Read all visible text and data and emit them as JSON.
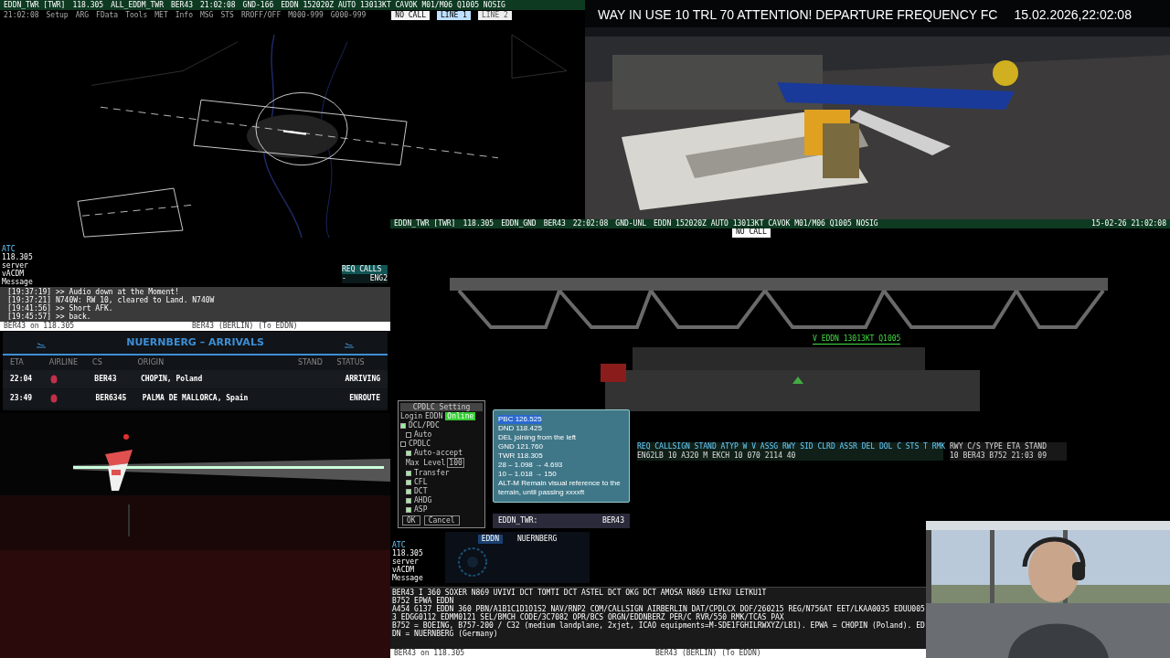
{
  "radar": {
    "toolbar": [
      "EDDN_TWR [TWR]",
      "118.305",
      "ALL_EDDM_TWR",
      "BER43",
      "21:02:08",
      "GND-166"
    ],
    "metar": "EDDN 152020Z AUTO 13013KT CAVOK M01/M06 Q1005 NOSIG",
    "menu": [
      "21:02:08",
      "Setup",
      "ARG",
      "FData",
      "Tools",
      "MET",
      "Info",
      "MSG",
      "STS",
      "RROFF/OFF",
      "M000-999",
      "G000-999"
    ],
    "call_status": "NO CALL",
    "lines": [
      {
        "label": "LINE 1",
        "selected": true
      },
      {
        "label": "LINE 2",
        "selected": false
      }
    ],
    "atc_box": [
      "ATC",
      "118.305",
      "server",
      "vACDM",
      "Message"
    ],
    "req_box": {
      "heading": "REQ CALLS",
      "values": [
        "-",
        "ENG2"
      ]
    },
    "messages": [
      "[19:37:19] >> Audio down at the Moment!",
      "[19:37:21] N740W: RW 10, cleared to Land. N740W",
      "[19:41:56] >> Short AFK.",
      "[19:45:57] >> back."
    ],
    "input": "BER43 on 118.305",
    "status": "BER43 (BERLIN) (To EDDN)"
  },
  "camera": {
    "ticker": "WAY IN USE 10 TRL 70 ATTENTION! DEPARTURE FREQUENCY FC",
    "datetime": "15.02.2026,22:02:08"
  },
  "arrivals": {
    "title": "NUERNBERG – ARRIVALS",
    "columns": [
      "ETA",
      "AIRLINE",
      "CS",
      "ORIGIN",
      "STAND",
      "STATUS"
    ],
    "rows": [
      {
        "eta": "22:04",
        "cs": "BER43",
        "origin": "CHOPIN, Poland",
        "status": "ARRIVING"
      },
      {
        "eta": "23:49",
        "cs": "BER6345",
        "origin": "PALMA DE MALLORCA, Spain",
        "status": "ENROUTE"
      }
    ]
  },
  "ground": {
    "toolbar": [
      "EDDN_TWR [TWR]",
      "118.305",
      "EDDN_GND",
      "BER43",
      "22:02:08",
      "GND-UNL"
    ],
    "metar": "EDDN 152020Z AUTO 13013KT CAVOK M01/M06 Q1005 NOSIG",
    "clock": "15-02-26 21:02:08",
    "call_status": "NO CALL",
    "wind_label": "V EDDN 13013KT Q1005",
    "strips": {
      "header": "REQ CALLSIGN STAND ATYP W V ASSG RWY SID CLRD ASSR DEL DOL C STS T RMK",
      "row": "EN62LB  10  A320 M  EKCH  10  070  2114  40"
    },
    "arrivals_strip": {
      "header": "RWY C/S  TYPE ETA  STAND",
      "row": "10  BER43  B752 21:03 09"
    },
    "cpdlc": {
      "title": "CPDLC Setting",
      "login_label": "Login",
      "station": "EDDN",
      "status": "Online",
      "online": true,
      "options": [
        {
          "label": "DCL/PDC",
          "checked": true,
          "children": [
            {
              "label": "Auto",
              "checked": false
            }
          ]
        },
        {
          "label": "CPDLC",
          "checked": false,
          "children": [
            {
              "label": "Auto-accept",
              "checked": true
            }
          ]
        }
      ],
      "max_level_label": "Max Level",
      "max_level": "100",
      "sub_options": [
        {
          "label": "Transfer",
          "checked": true
        },
        {
          "label": "CFL",
          "checked": true
        },
        {
          "label": "DCT",
          "checked": true
        },
        {
          "label": "AHDG",
          "checked": true
        },
        {
          "label": "ASP",
          "checked": true
        }
      ],
      "buttons": [
        "OK",
        "Cancel"
      ]
    },
    "note": {
      "lines": [
        {
          "text": "PBC 126.525",
          "selected": true
        },
        {
          "text": "DND 118.425",
          "selected": false
        },
        {
          "text": "DEL joining from the left",
          "selected": false
        },
        {
          "text": "GND 121.760",
          "selected": false
        },
        {
          "text": "TWR 118.305",
          "selected": false
        },
        {
          "text": "28 – 1.098 → 4.693",
          "selected": false
        },
        {
          "text": "10 – 1.018 → 150",
          "selected": false
        },
        {
          "text": "ALT-M Remain visual reference to the terrain, until passing xxxxft",
          "selected": false
        }
      ]
    },
    "handoff": {
      "station": "EDDN_TWR:",
      "callsign": "BER43"
    },
    "acdm": {
      "airport": "EDDN",
      "name": "NUERNBERG"
    },
    "atc_box": [
      "ATC",
      "118.305",
      "server",
      "vACDM",
      "Message"
    ],
    "messages": [
      "BER43    I             360   SOXER N869 UVIVI DCT TOMTI DCT ASTEL DCT OKG DCT AMOSA N869 LETKU LETKU1T",
      "B752     EPWA EDDN",
      "A454 G137     EDDN   360   PBN/A1B1C1D1O1S2 NAV/RNP2 COM/CALLSIGN AIRBERLIN DAT/CPDLCX DOF/260215 REG/N756AT EET/LKAA0035 EDUU0053 EDGG0112 EDMM0121 SEL/BMCH CODE/3C7082 OPR/BCS ORGN/EDDNBERZ PER/C RVR/550 RMK/TCAS PAX",
      "B752 = BOEING, B757-200 / C32 (medium landplane, 2xjet, ICAO equipments=M-SDE1FGHILRWXYZ/LB1). EPWA = CHOPIN (Poland). EDDN = NUERNBERG (Germany)"
    ],
    "input": "BER43 on 118.305",
    "status": "BER43 (BERLIN) (To EDDN)"
  }
}
